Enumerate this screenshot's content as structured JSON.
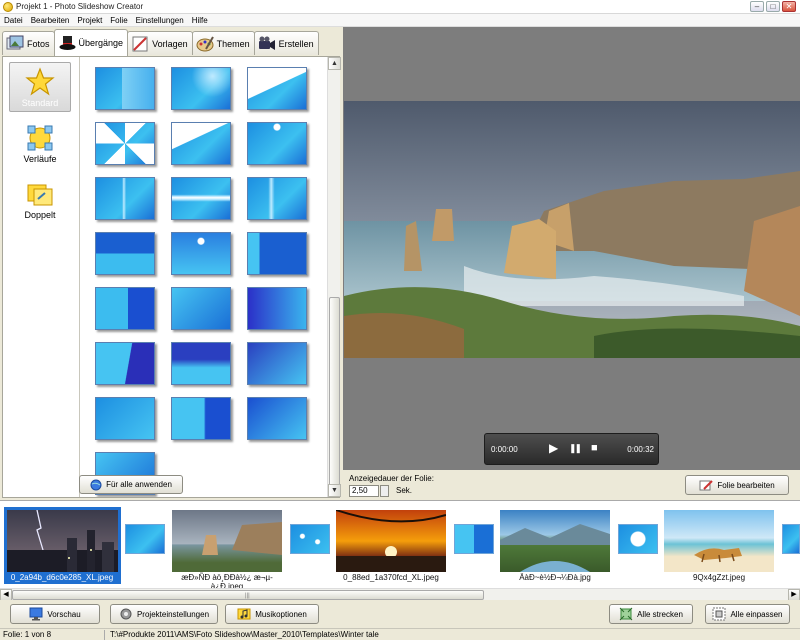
{
  "window": {
    "title": "Projekt 1 - Photo Slideshow Creator",
    "buttons": [
      "–",
      "□",
      "✕"
    ]
  },
  "menu": [
    "Datei",
    "Bearbeiten",
    "Projekt",
    "Folie",
    "Einstellungen",
    "Hilfe"
  ],
  "tabs": [
    {
      "label": "Fotos",
      "icon": "photos-icon"
    },
    {
      "label": "Übergänge",
      "icon": "top-hat-icon",
      "active": true
    },
    {
      "label": "Vorlagen",
      "icon": "templates-icon"
    },
    {
      "label": "Themen",
      "icon": "palette-icon"
    },
    {
      "label": "Erstellen",
      "icon": "video-camera-icon"
    }
  ],
  "categories": [
    {
      "label": "Standard",
      "icon": "star-icon",
      "selected": true
    },
    {
      "label": "Verläufe",
      "icon": "gradient-icon"
    },
    {
      "label": "Doppelt",
      "icon": "double-icon"
    }
  ],
  "apply_all_label": "Für alle anwenden",
  "player": {
    "current": "0:00:00",
    "total": "0:00:32",
    "play": "▶",
    "pause": "❚❚",
    "stop": "■"
  },
  "duration": {
    "label": "Anzeigedauer der Folie:",
    "value": "2,50",
    "unit": "Sek."
  },
  "edit_slide_label": "Folie bearbeiten",
  "filmstrip": [
    {
      "caption": "0_2a94b_d6c0e285_XL.jpeg",
      "selected": true
    },
    {
      "caption": "æÐ»ÑÐ àö¸ÐÐà½¿ æ¬µ­à¿Ð.jpeg"
    },
    {
      "caption": "0_88ed_1a370fcd_XL.jpeg"
    },
    {
      "caption": "ÄàÐ~è½Ð¬¼Ðà.jpg"
    },
    {
      "caption": "9Qx4gZzt.jpeg"
    }
  ],
  "bottom_buttons": {
    "preview": "Vorschau",
    "project_settings": "Projekteinstellungen",
    "music_options": "Musikoptionen",
    "stretch_all": "Alle strecken",
    "fit_all": "Alle einpassen"
  },
  "status": {
    "slide": "Folie: 1 von 8",
    "path": "T:\\#Produkte 2011\\AMS\\Foto Slideshow\\Master_2010\\Templates\\Winter tale"
  },
  "colors": {
    "accent_blue": "#1f6fd0",
    "transition_blue": "#2aa5e8",
    "panel_bg": "#ece9d8"
  }
}
